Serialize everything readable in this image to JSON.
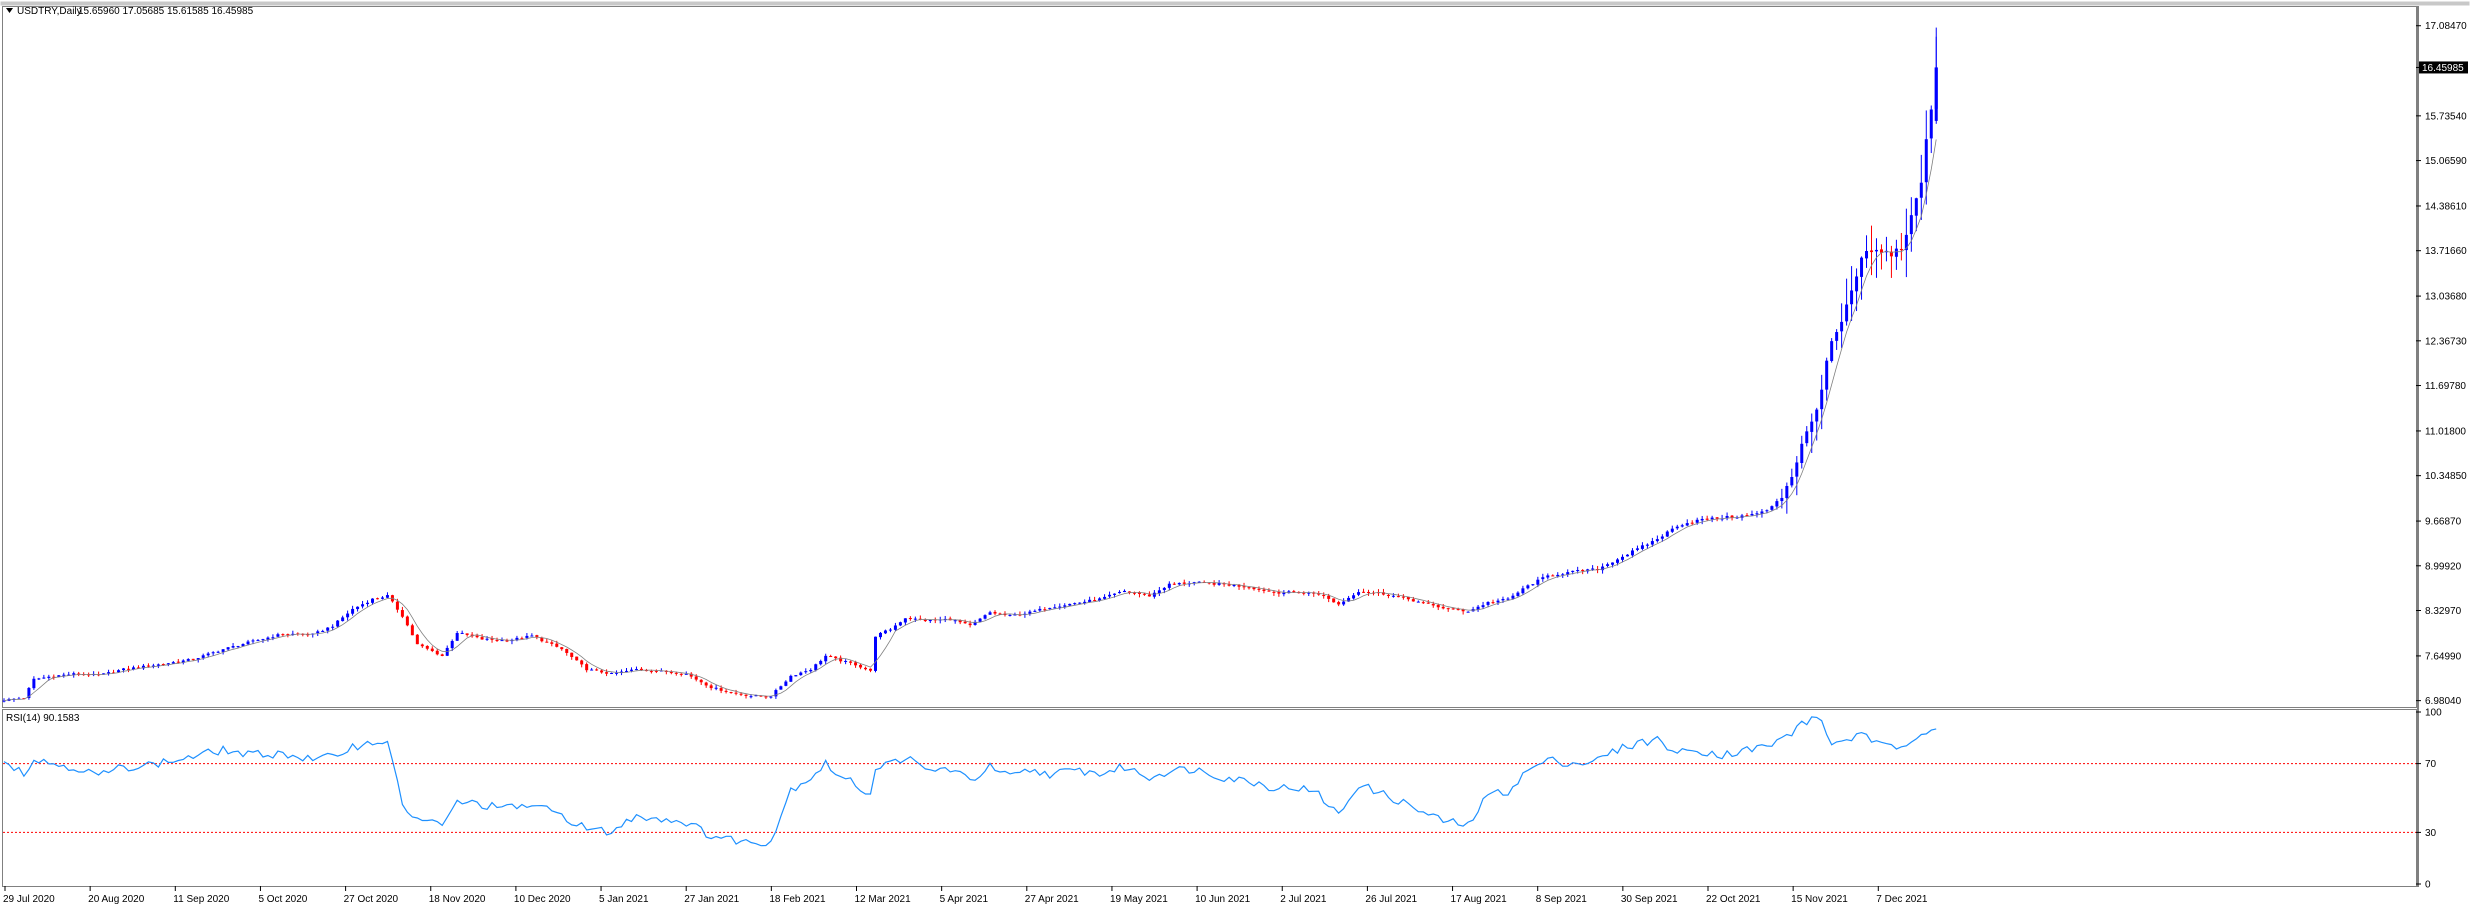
{
  "header": {
    "symbol": "USDTRY,Daily",
    "ohlc": "15.65960 17.05685 15.61585 16.45985",
    "toggle_icon": "triangle-down-icon"
  },
  "rsi_panel": {
    "label": "RSI(14) 90.1583"
  },
  "colors": {
    "bull": "#0000ff",
    "bear": "#ff0000",
    "ma_line": "#808080",
    "rsi_line": "#1e90ff",
    "level_line": "#ff0000",
    "border": "#808080",
    "price_tag_bg": "#000000",
    "price_tag_fg": "#ffffff"
  },
  "chart_data": [
    {
      "type": "candlestick",
      "title": "USDTRY,Daily",
      "yticks": [
        "17.08470",
        "16.45985",
        "15.73540",
        "15.06590",
        "14.38610",
        "13.71660",
        "13.03680",
        "12.36730",
        "11.69780",
        "11.01800",
        "10.34850",
        "9.66870",
        "8.99920",
        "8.32970",
        "7.64990",
        "6.98040"
      ],
      "current_price": "16.45985",
      "xticks": [
        "29 Jul 2020",
        "20 Aug 2020",
        "11 Sep 2020",
        "5 Oct 2020",
        "27 Oct 2020",
        "18 Nov 2020",
        "10 Dec 2020",
        "5 Jan 2021",
        "27 Jan 2021",
        "18 Feb 2021",
        "12 Mar 2021",
        "5 Apr 2021",
        "27 Apr 2021",
        "19 May 2021",
        "10 Jun 2021",
        "2 Jul 2021",
        "26 Jul 2021",
        "17 Aug 2021",
        "8 Sep 2021",
        "30 Sep 2021",
        "22 Oct 2021",
        "15 Nov 2021",
        "7 Dec 2021"
      ],
      "ylim": [
        6.9,
        17.35
      ],
      "close_path": [
        [
          0,
          6.99
        ],
        [
          4,
          7.02
        ],
        [
          6,
          7.3
        ],
        [
          10,
          7.35
        ],
        [
          14,
          7.38
        ],
        [
          19,
          7.36
        ],
        [
          24,
          7.45
        ],
        [
          31,
          7.52
        ],
        [
          38,
          7.6
        ],
        [
          44,
          7.75
        ],
        [
          49,
          7.85
        ],
        [
          56,
          7.98
        ],
        [
          62,
          7.97
        ],
        [
          66,
          8.1
        ],
        [
          70,
          8.35
        ],
        [
          74,
          8.5
        ],
        [
          77,
          8.55
        ],
        [
          80,
          8.25
        ],
        [
          83,
          7.82
        ],
        [
          86,
          7.72
        ],
        [
          88,
          7.65
        ],
        [
          91,
          8.0
        ],
        [
          96,
          7.9
        ],
        [
          101,
          7.88
        ],
        [
          106,
          7.95
        ],
        [
          112,
          7.75
        ],
        [
          117,
          7.45
        ],
        [
          122,
          7.38
        ],
        [
          127,
          7.45
        ],
        [
          132,
          7.42
        ],
        [
          137,
          7.38
        ],
        [
          142,
          7.18
        ],
        [
          146,
          7.1
        ],
        [
          150,
          7.05
        ],
        [
          154,
          7.05
        ],
        [
          158,
          7.35
        ],
        [
          162,
          7.45
        ],
        [
          165,
          7.65
        ],
        [
          168,
          7.58
        ],
        [
          171,
          7.52
        ],
        [
          174,
          7.42
        ],
        [
          175,
          7.95
        ],
        [
          178,
          8.05
        ],
        [
          181,
          8.22
        ],
        [
          185,
          8.18
        ],
        [
          190,
          8.2
        ],
        [
          194,
          8.1
        ],
        [
          198,
          8.3
        ],
        [
          202,
          8.25
        ],
        [
          206,
          8.3
        ],
        [
          210,
          8.38
        ],
        [
          216,
          8.45
        ],
        [
          220,
          8.5
        ],
        [
          225,
          8.62
        ],
        [
          230,
          8.55
        ],
        [
          234,
          8.72
        ],
        [
          239,
          8.75
        ],
        [
          245,
          8.72
        ],
        [
          250,
          8.68
        ],
        [
          255,
          8.6
        ],
        [
          260,
          8.6
        ],
        [
          264,
          8.58
        ],
        [
          268,
          8.42
        ],
        [
          272,
          8.62
        ],
        [
          277,
          8.58
        ],
        [
          282,
          8.5
        ],
        [
          286,
          8.42
        ],
        [
          290,
          8.35
        ],
        [
          294,
          8.32
        ],
        [
          298,
          8.45
        ],
        [
          302,
          8.5
        ],
        [
          306,
          8.7
        ],
        [
          310,
          8.85
        ],
        [
          316,
          8.92
        ],
        [
          320,
          8.95
        ],
        [
          324,
          9.1
        ],
        [
          328,
          9.25
        ],
        [
          332,
          9.4
        ],
        [
          336,
          9.6
        ],
        [
          340,
          9.68
        ],
        [
          345,
          9.72
        ],
        [
          350,
          9.75
        ],
        [
          354,
          9.82
        ],
        [
          357,
          10.05
        ],
        [
          359,
          10.35
        ],
        [
          361,
          10.8
        ],
        [
          363,
          11.15
        ],
        [
          365,
          11.65
        ],
        [
          367,
          12.35
        ],
        [
          369,
          12.6
        ],
        [
          371,
          13.1
        ],
        [
          373,
          13.55
        ],
        [
          375,
          13.72
        ],
        [
          377,
          13.65
        ],
        [
          379,
          13.7
        ],
        [
          381,
          13.75
        ],
        [
          383,
          14.2
        ],
        [
          385,
          14.75
        ],
        [
          387,
          15.9
        ],
        [
          388,
          16.46
        ]
      ],
      "rsi": {
        "label": "RSI(14) 90.1583",
        "yticks": [
          "100",
          "70",
          "30",
          "0"
        ],
        "levels": [
          70,
          30
        ],
        "ylim": [
          0,
          100
        ],
        "path": [
          [
            0,
            72
          ],
          [
            4,
            65
          ],
          [
            6,
            72
          ],
          [
            10,
            70
          ],
          [
            14,
            68
          ],
          [
            19,
            63
          ],
          [
            24,
            68
          ],
          [
            31,
            70
          ],
          [
            38,
            74
          ],
          [
            44,
            78
          ],
          [
            49,
            75
          ],
          [
            56,
            76
          ],
          [
            62,
            72
          ],
          [
            66,
            74
          ],
          [
            70,
            80
          ],
          [
            74,
            82
          ],
          [
            77,
            84
          ],
          [
            80,
            45
          ],
          [
            83,
            38
          ],
          [
            86,
            36
          ],
          [
            88,
            33
          ],
          [
            91,
            48
          ],
          [
            96,
            46
          ],
          [
            101,
            44
          ],
          [
            106,
            46
          ],
          [
            112,
            40
          ],
          [
            117,
            32
          ],
          [
            122,
            30
          ],
          [
            127,
            40
          ],
          [
            132,
            38
          ],
          [
            137,
            36
          ],
          [
            142,
            28
          ],
          [
            146,
            26
          ],
          [
            150,
            24
          ],
          [
            154,
            25
          ],
          [
            158,
            55
          ],
          [
            162,
            62
          ],
          [
            165,
            70
          ],
          [
            168,
            62
          ],
          [
            171,
            58
          ],
          [
            174,
            52
          ],
          [
            175,
            68
          ],
          [
            178,
            70
          ],
          [
            181,
            74
          ],
          [
            185,
            66
          ],
          [
            190,
            67
          ],
          [
            194,
            60
          ],
          [
            198,
            68
          ],
          [
            202,
            62
          ],
          [
            206,
            66
          ],
          [
            210,
            64
          ],
          [
            216,
            66
          ],
          [
            220,
            64
          ],
          [
            225,
            68
          ],
          [
            230,
            62
          ],
          [
            234,
            66
          ],
          [
            239,
            67
          ],
          [
            245,
            62
          ],
          [
            250,
            60
          ],
          [
            255,
            56
          ],
          [
            260,
            56
          ],
          [
            264,
            52
          ],
          [
            268,
            40
          ],
          [
            272,
            58
          ],
          [
            277,
            52
          ],
          [
            282,
            46
          ],
          [
            286,
            40
          ],
          [
            290,
            36
          ],
          [
            294,
            34
          ],
          [
            298,
            52
          ],
          [
            302,
            54
          ],
          [
            306,
            66
          ],
          [
            310,
            72
          ],
          [
            316,
            70
          ],
          [
            320,
            72
          ],
          [
            324,
            78
          ],
          [
            328,
            82
          ],
          [
            332,
            84
          ],
          [
            336,
            76
          ],
          [
            340,
            78
          ],
          [
            345,
            75
          ],
          [
            350,
            78
          ],
          [
            354,
            80
          ],
          [
            357,
            84
          ],
          [
            359,
            88
          ],
          [
            361,
            94
          ],
          [
            363,
            95
          ],
          [
            365,
            96
          ],
          [
            367,
            80
          ],
          [
            369,
            84
          ],
          [
            371,
            85
          ],
          [
            373,
            86
          ],
          [
            375,
            84
          ],
          [
            377,
            80
          ],
          [
            379,
            80
          ],
          [
            381,
            80
          ],
          [
            383,
            85
          ],
          [
            385,
            88
          ],
          [
            387,
            90
          ],
          [
            388,
            90.16
          ]
        ]
      }
    }
  ]
}
